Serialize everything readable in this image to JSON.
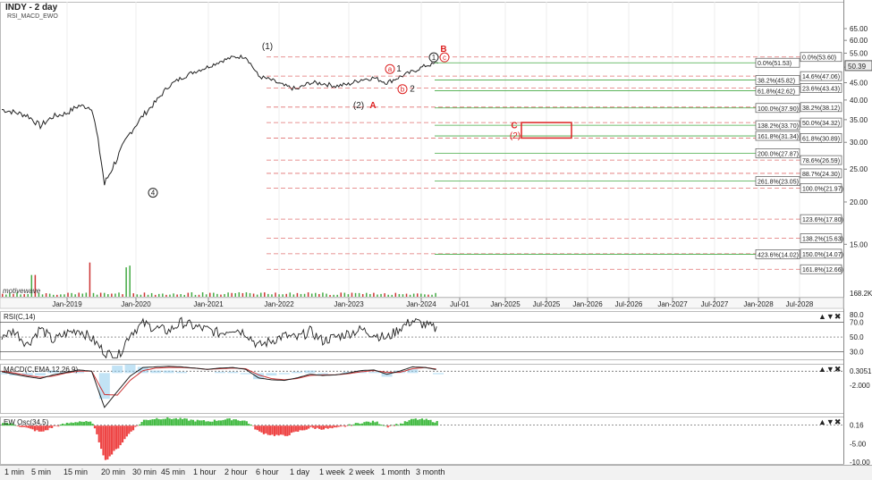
{
  "header": {
    "title": "INDY - 2 day",
    "studies": "RSI_MACD_EWO"
  },
  "watermark": "motivewave",
  "colors": {
    "price": "#222222",
    "fib_red": "#e07070",
    "fib_green": "#44aa44",
    "wave_red": "#dd2222",
    "bg": "#ffffff",
    "panel_border": "#888888"
  },
  "chart_data": [
    {
      "type": "line",
      "title": "INDY - 2 day",
      "x": [
        "2018-06",
        "2018-09",
        "2018-12",
        "2019-03",
        "2019-06",
        "2019-09",
        "2019-12",
        "2020-02",
        "2020-03",
        "2020-04",
        "2020-06",
        "2020-08",
        "2020-10",
        "2020-12",
        "2021-02",
        "2021-04",
        "2021-06",
        "2021-08",
        "2021-10",
        "2021-12",
        "2022-01",
        "2022-03",
        "2022-05",
        "2022-07",
        "2022-09",
        "2022-11",
        "2023-01",
        "2023-03",
        "2023-05",
        "2023-07",
        "2023-09",
        "2023-11",
        "2024-01",
        "2024-03",
        "2024-05"
      ],
      "series": [
        {
          "values": [
            37.5,
            36.8,
            36.0,
            33.5,
            35.8,
            36.5,
            38.5,
            38.0,
            22.5,
            27.0,
            32.0,
            36.0,
            39.5,
            44.0,
            46.5,
            48.5,
            50.0,
            52.0,
            53.5,
            53.8,
            47.0,
            45.8,
            44.0,
            43.0,
            45.0,
            44.8,
            44.0,
            44.5,
            46.0,
            46.5,
            45.0,
            46.8,
            48.5,
            50.5,
            51.4
          ]
        }
      ],
      "x_tick_labels": [
        "Jan-2019",
        "Jan-2020",
        "Jan-2021",
        "Jan-2022",
        "Jan-2023",
        "Jan-2024",
        "Jul-01",
        "Jan-2025",
        "Jul-2025",
        "Jan-2026",
        "Jul-2026",
        "Jan-2027",
        "Jul-2027",
        "Jan-2028",
        "Jul-2028"
      ],
      "y_tick_labels": [
        "65.00",
        "60.00",
        "55.00",
        "50.00",
        "45.00",
        "40.00",
        "35.00",
        "30.00",
        "25.00",
        "20.00",
        "15.00",
        "10.00"
      ],
      "y_scale": "log",
      "ylim": [
        10.5,
        78
      ],
      "current_price_label": "50.39",
      "volume_label": "168.2K",
      "wave_labels": [
        {
          "text": "(1)",
          "color": "black"
        },
        {
          "text": "4",
          "color": "black",
          "circled": true
        },
        {
          "text": "a",
          "color": "red",
          "circled": true
        },
        {
          "text": "1",
          "color": "black"
        },
        {
          "text": "b",
          "color": "red",
          "circled": true
        },
        {
          "text": "2",
          "color": "black"
        },
        {
          "text": "(2)",
          "color": "black"
        },
        {
          "text": "A",
          "color": "red"
        },
        {
          "text": "B",
          "color": "red"
        },
        {
          "text": "1",
          "color": "black",
          "circled": true
        },
        {
          "text": "c",
          "color": "red",
          "circled": true
        },
        {
          "text": "C",
          "color": "red"
        },
        {
          "text": "(2)",
          "color": "red"
        }
      ],
      "fib_green": [
        {
          "label": "0.0%(51.53)",
          "price": 51.53
        },
        {
          "label": "38.2%(45.82)",
          "price": 45.82
        },
        {
          "label": "61.8%(42.62)",
          "price": 42.62
        },
        {
          "label": "100.0%(37.90)",
          "price": 37.9
        },
        {
          "label": "138.2%(33.70)",
          "price": 33.7
        },
        {
          "label": "161.8%(31.34)",
          "price": 31.34
        },
        {
          "label": "200.0%(27.87)",
          "price": 27.87
        },
        {
          "label": "261.8%(23.05)",
          "price": 23.05
        },
        {
          "label": "423.6%(14.02)",
          "price": 14.02
        }
      ],
      "fib_red": [
        {
          "label": "0.0%(53.60)",
          "price": 53.6
        },
        {
          "label": "14.6%(47.06)",
          "price": 47.06
        },
        {
          "label": "23.6%(43.43)",
          "price": 43.43
        },
        {
          "label": "38.2%(38.12)",
          "price": 38.12
        },
        {
          "label": "50.0%(34.32)",
          "price": 34.32
        },
        {
          "label": "61.8%(30.89)",
          "price": 30.89
        },
        {
          "label": "78.6%(26.59)",
          "price": 26.59
        },
        {
          "label": "88.7%(24.30)",
          "price": 24.3
        },
        {
          "label": "100.0%(21.97)",
          "price": 21.97
        },
        {
          "label": "123.6%(17.80)",
          "price": 17.8
        },
        {
          "label": "138.2%(15.63)",
          "price": 15.63
        },
        {
          "label": "150.0%(14.07)",
          "price": 14.07
        },
        {
          "label": "161.8%(12.66)",
          "price": 12.66
        }
      ]
    },
    {
      "type": "line",
      "title": "RSI(C,14)",
      "y_tick_labels": [
        "80.0",
        "70.0",
        "50.0",
        "30.0"
      ],
      "ylim": [
        20,
        85
      ],
      "guides": [
        70,
        50,
        30
      ],
      "series": [
        {
          "values": [
            52,
            58,
            40,
            62,
            45,
            55,
            60,
            48,
            30,
            22,
            55,
            68,
            62,
            58,
            70,
            64,
            60,
            55,
            62,
            56,
            38,
            45,
            52,
            48,
            58,
            45,
            50,
            55,
            60,
            54,
            48,
            62,
            72,
            66,
            60
          ]
        }
      ]
    },
    {
      "type": "line",
      "title": "MACD(C,EMA,12,26,9)",
      "y_tick_labels": [
        "0.3051",
        "-2.000"
      ],
      "ylim": [
        -6.5,
        1.5
      ],
      "series": [
        {
          "name": "MACD",
          "values": [
            0.2,
            -0.2,
            -0.6,
            -0.9,
            -0.3,
            0.1,
            0.5,
            0.3,
            -5.6,
            -3.0,
            -0.5,
            0.9,
            1.0,
            1.1,
            1.0,
            0.8,
            0.6,
            0.8,
            0.9,
            0.6,
            -0.8,
            -1.1,
            -1.2,
            -0.8,
            -0.2,
            -0.4,
            -0.3,
            0.0,
            0.4,
            0.5,
            -0.2,
            0.3,
            1.0,
            0.9,
            0.5
          ]
        },
        {
          "name": "Signal",
          "values": [
            0.3,
            0.0,
            -0.4,
            -0.7,
            -0.5,
            0.0,
            0.3,
            0.3,
            -3.5,
            -3.6,
            -1.2,
            0.4,
            0.8,
            0.9,
            0.9,
            0.8,
            0.6,
            0.7,
            0.8,
            0.7,
            -0.3,
            -0.9,
            -1.1,
            -0.9,
            -0.4,
            -0.3,
            -0.3,
            -0.1,
            0.2,
            0.4,
            0.1,
            0.1,
            0.7,
            0.9,
            0.6
          ]
        }
      ]
    },
    {
      "type": "bar",
      "title": "EW Osc(34,5)",
      "y_tick_labels": [
        "0.16",
        "-5.00",
        "-10.00"
      ],
      "ylim": [
        -10.5,
        2.5
      ],
      "values": [
        1.0,
        0.2,
        -0.8,
        -1.8,
        -0.3,
        0.6,
        1.2,
        0.8,
        -9.6,
        -6.0,
        -1.5,
        1.5,
        2.0,
        2.0,
        1.8,
        1.4,
        1.2,
        1.6,
        1.8,
        1.2,
        -1.8,
        -2.6,
        -2.8,
        -1.6,
        -0.6,
        -0.9,
        -0.7,
        0.1,
        0.9,
        1.1,
        -0.2,
        0.5,
        1.8,
        1.6,
        0.9
      ]
    }
  ],
  "panels": {
    "rsi_title": "RSI(C,14)",
    "macd_title": "MACD(C,EMA,12,26,9)",
    "ewo_title": "EW Osc(34,5)",
    "panel_controls": "▲▼✖"
  },
  "toolbar": {
    "timeframes": [
      "1 min",
      "5 min",
      "15 min",
      "20 min",
      "30 min",
      "45 min",
      "1 hour",
      "2 hour",
      "6 hour",
      "1 day",
      "1 week",
      "2 week",
      "1 month",
      "3 month"
    ]
  }
}
